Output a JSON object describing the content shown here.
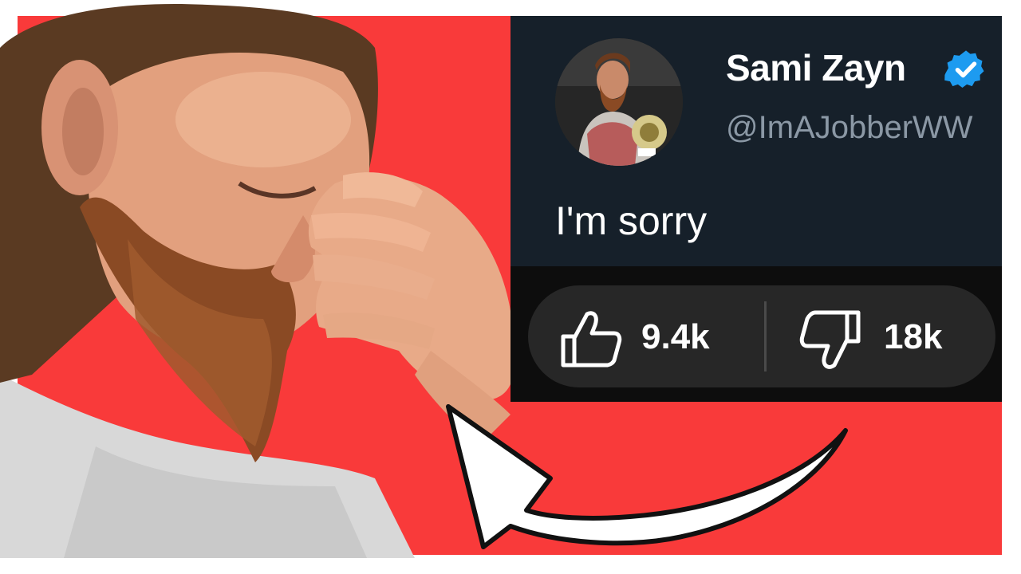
{
  "tweet": {
    "display_name": "Sami Zayn",
    "handle": "@ImAJobberWW",
    "text": "I'm sorry",
    "verified_icon": "verified-badge-icon",
    "avatar_icon": "avatar"
  },
  "votes": {
    "like_count": "9.4k",
    "dislike_count": "18k",
    "like_icon": "thumbs-up-icon",
    "dislike_icon": "thumbs-down-icon"
  },
  "colors": {
    "background_red": "#f93a3a",
    "tweet_card": "#16202a",
    "verified_blue": "#1d9bf0",
    "vote_pill": "#272727",
    "arrow": "#ffffff"
  }
}
